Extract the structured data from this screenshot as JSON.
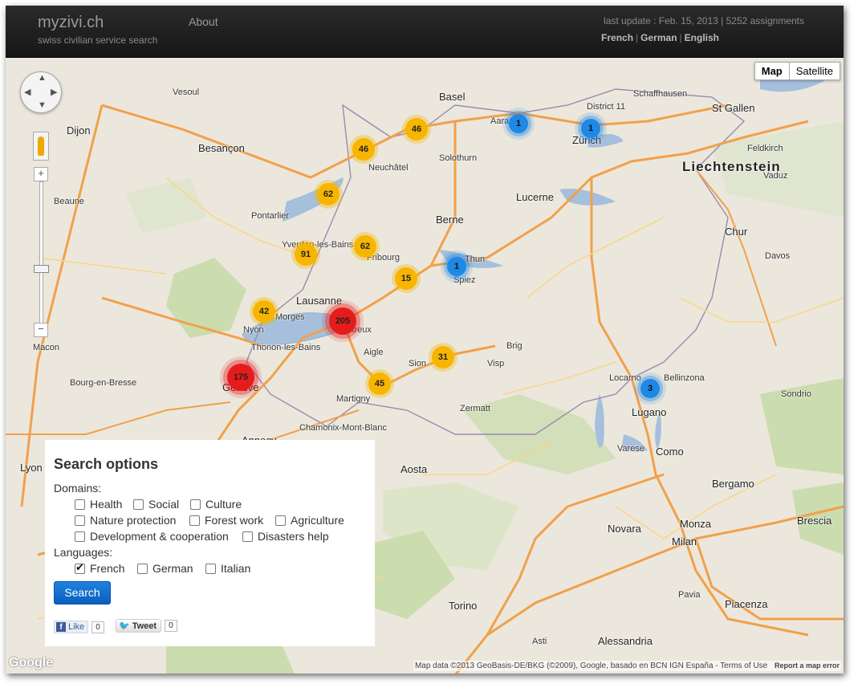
{
  "header": {
    "brand": "myzivi.ch",
    "tagline": "swiss civilian service search",
    "nav_about": "About",
    "update": "last update : Feb. 15, 2013 | 5252 assignments",
    "languages": [
      "French",
      "German",
      "English"
    ]
  },
  "map": {
    "type_buttons": [
      "Map",
      "Satellite"
    ],
    "active_type": "Map",
    "attribution": "Map data ©2013 GeoBasis-DE/BKG (©2009), Google, basado en BCN IGN España -",
    "terms": "Terms of Use",
    "report": "Report a map error",
    "logo": "Google",
    "clusters": [
      {
        "label": "46",
        "color": "yellow"
      },
      {
        "label": "46",
        "color": "yellow"
      },
      {
        "label": "62",
        "color": "yellow"
      },
      {
        "label": "91",
        "color": "yellow"
      },
      {
        "label": "62",
        "color": "yellow"
      },
      {
        "label": "15",
        "color": "yellow"
      },
      {
        "label": "42",
        "color": "yellow"
      },
      {
        "label": "205",
        "color": "red"
      },
      {
        "label": "175",
        "color": "red"
      },
      {
        "label": "31",
        "color": "yellow"
      },
      {
        "label": "45",
        "color": "yellow"
      },
      {
        "label": "1",
        "color": "blue"
      },
      {
        "label": "1",
        "color": "blue"
      },
      {
        "label": "1",
        "color": "blue"
      },
      {
        "label": "3",
        "color": "blue"
      }
    ],
    "places": {
      "basel": "Basel",
      "zurich": "Zürich",
      "bern": "Berne",
      "lausanne": "Lausanne",
      "geneva": "Genève",
      "lucerne": "Lucerne",
      "dijon": "Dijon",
      "besancon": "Besançon",
      "lugano": "Lugano",
      "milan": "Milan",
      "torino": "Torino",
      "aosta": "Aosta",
      "bergamo": "Bergamo",
      "como": "Como",
      "stgallen": "St Gallen",
      "chur": "Chur",
      "fribourg": "Fribourg",
      "neuchatel": "Neuchâtel",
      "sion": "Sion",
      "montreux": "Montreux",
      "interlaken": "Thun",
      "monza": "Monza",
      "novara": "Novara",
      "brescia": "Brescia",
      "lyon": "Lyon",
      "annecy": "Annecy",
      "yverdon": "Yverdon-les-Bains",
      "solothurn": "Solothurn",
      "aarau": "Aarau",
      "winterthur": "District 11",
      "schaffhausen": "Schaffhausen",
      "davos": "Davos",
      "piacenza": "Piacenza",
      "alessandria": "Alessandria",
      "asti": "Asti",
      "pavia": "Pavia",
      "varese": "Varese",
      "locarno": "Locarno",
      "bellinzona": "Bellinzona",
      "martigny": "Martigny",
      "aigle": "Aigle",
      "spiez": "Spiez",
      "morges": "Morges",
      "nyon": "Nyon",
      "thonon": "Thonon-les-Bains",
      "pontarlier": "Pontarlier",
      "vesoul": "Vesoul",
      "beaune": "Beaune",
      "macon": "Macon",
      "bourg": "Bourg-en-Bresse",
      "chamonix": "Chamonix-Mont-Blanc",
      "zermatt": "Zermatt",
      "brig": "Brig",
      "visp": "Visp",
      "sondrio": "Sondrio",
      "vaduz": "Vaduz",
      "feldkirch": "Feldkirch"
    },
    "country_label": "Liechtenstein"
  },
  "search": {
    "title": "Search options",
    "domains_label": "Domains:",
    "domains": [
      {
        "label": "Health",
        "checked": false
      },
      {
        "label": "Social",
        "checked": false
      },
      {
        "label": "Culture",
        "checked": false
      },
      {
        "label": "Nature protection",
        "checked": false
      },
      {
        "label": "Forest work",
        "checked": false
      },
      {
        "label": "Agriculture",
        "checked": false
      },
      {
        "label": "Development & cooperation",
        "checked": false
      },
      {
        "label": "Disasters help",
        "checked": false
      }
    ],
    "languages_label": "Languages:",
    "languages": [
      {
        "label": "French",
        "checked": true
      },
      {
        "label": "German",
        "checked": false
      },
      {
        "label": "Italian",
        "checked": false
      }
    ],
    "button": "Search",
    "like_label": "Like",
    "like_count": "0",
    "tweet_label": "Tweet",
    "tweet_count": "0"
  },
  "colors": {
    "navbar": "#1c1c1c",
    "cluster_yellow": "#f7b500",
    "cluster_red": "#e61b1b",
    "cluster_blue": "#1e88e5",
    "lake": "#a5bfdd",
    "forest": "#cbdcae",
    "search_button": "#0d6fd1"
  }
}
